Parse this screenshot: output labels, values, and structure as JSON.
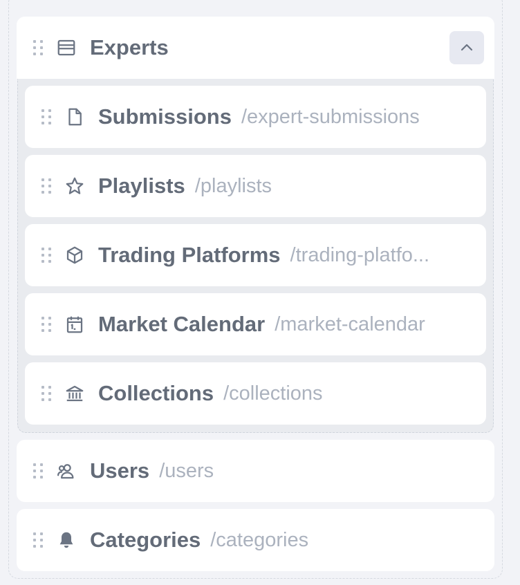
{
  "group": {
    "label": "Experts",
    "icon": "panel-icon",
    "collapse_icon": "chevron-up-icon"
  },
  "children": [
    {
      "label": "Submissions",
      "path": "/expert-submissions",
      "icon": "file-icon"
    },
    {
      "label": "Playlists",
      "path": "/playlists",
      "icon": "star-icon"
    },
    {
      "label": "Trading Platforms",
      "path": "/trading-platfo...",
      "icon": "cube-icon"
    },
    {
      "label": "Market Calendar",
      "path": "/market-calendar",
      "icon": "calendar-icon"
    },
    {
      "label": "Collections",
      "path": "/collections",
      "icon": "bank-icon"
    }
  ],
  "top_items": [
    {
      "label": "Users",
      "path": "/users",
      "icon": "users-icon"
    },
    {
      "label": "Categories",
      "path": "/categories",
      "icon": "bell-icon"
    }
  ],
  "colors": {
    "background": "#f2f3f7",
    "card": "#ffffff",
    "group_body": "#e9ebef",
    "label": "#636b78",
    "path": "#abb2be"
  }
}
